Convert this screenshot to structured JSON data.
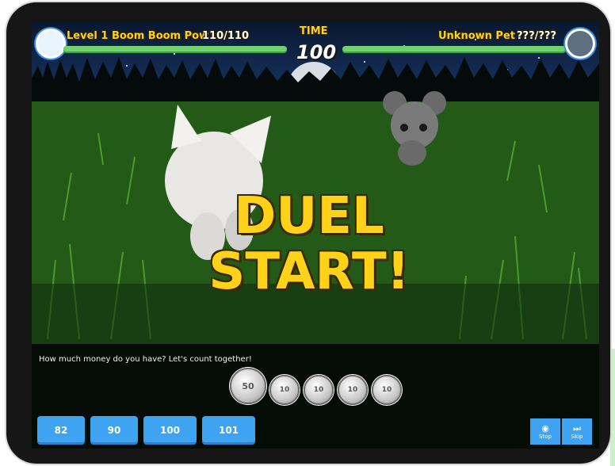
{
  "hud": {
    "player_name": "Level 1 Boom Boom Pow",
    "player_hp": "110/110",
    "timer_label": "TIME",
    "timer_value": "100",
    "opponent_name": "Unknown Pet",
    "opponent_hp": "???/???",
    "player_hp_fraction": 1.0,
    "opponent_hp_fraction": 1.0
  },
  "banner": {
    "line1": "DUEL",
    "line2": "START!"
  },
  "question": {
    "text": "How much money do you have? Let's count together!"
  },
  "coins": [
    {
      "label": "50",
      "kind": "large"
    },
    {
      "label": "10",
      "kind": "small"
    },
    {
      "label": "10",
      "kind": "small"
    },
    {
      "label": "10",
      "kind": "small"
    },
    {
      "label": "10",
      "kind": "small"
    }
  ],
  "answers": [
    "82",
    "90",
    "100",
    "101"
  ],
  "controls": {
    "stop_label": "Stop",
    "skip_label": "Skip"
  },
  "colors": {
    "hp_bar": "#6fd26f",
    "accent_text": "#ffd21a",
    "button": "#3ea4f2"
  }
}
